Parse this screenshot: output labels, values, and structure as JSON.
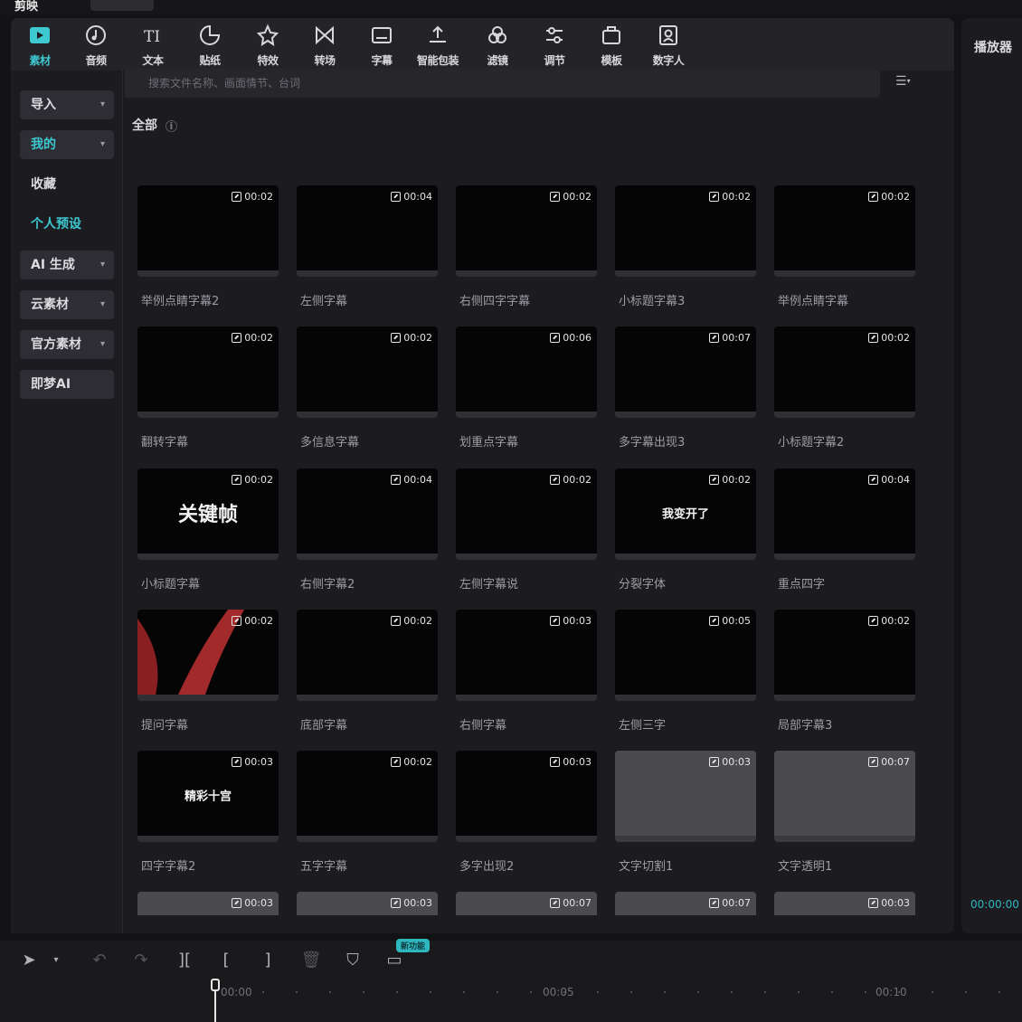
{
  "app": {
    "title": "剪映"
  },
  "toolbar": {
    "tools": [
      {
        "label": "素材",
        "icon": "media-icon",
        "active": true
      },
      {
        "label": "音频",
        "icon": "audio-icon"
      },
      {
        "label": "文本",
        "icon": "text-icon"
      },
      {
        "label": "贴纸",
        "icon": "sticker-icon"
      },
      {
        "label": "特效",
        "icon": "effects-icon"
      },
      {
        "label": "转场",
        "icon": "transition-icon"
      },
      {
        "label": "字幕",
        "icon": "subtitle-icon"
      },
      {
        "label": "智能包装",
        "icon": "smart-pack-icon"
      },
      {
        "label": "滤镜",
        "icon": "filter-icon"
      },
      {
        "label": "调节",
        "icon": "adjust-icon"
      },
      {
        "label": "模板",
        "icon": "template-icon"
      },
      {
        "label": "数字人",
        "icon": "avatar-icon"
      }
    ]
  },
  "sidebar": {
    "items": [
      {
        "label": "导入",
        "style": "btn",
        "chevron": "▾"
      },
      {
        "label": "我的",
        "style": "sel",
        "chevron": "▾"
      },
      {
        "label": "收藏",
        "style": "plain"
      },
      {
        "label": "个人预设",
        "style": "plain accent"
      },
      {
        "label": "AI 生成",
        "style": "btn",
        "chevron": "▾"
      },
      {
        "label": "云素材",
        "style": "btn",
        "chevron": "▾"
      },
      {
        "label": "官方素材",
        "style": "btn",
        "chevron": "▾"
      },
      {
        "label": "即梦AI",
        "style": "btn"
      }
    ]
  },
  "search": {
    "placeholder": "搜索文件名称、画面情节、台词"
  },
  "sort": {
    "icon": "sort-icon",
    "caret": "▾"
  },
  "section": {
    "title": "全部",
    "info": "i"
  },
  "grid": {
    "items": [
      {
        "duration": "00:02",
        "label": "举例点睛字幕2"
      },
      {
        "duration": "00:04",
        "label": "左侧字幕"
      },
      {
        "duration": "00:02",
        "label": "右侧四字字幕"
      },
      {
        "duration": "00:02",
        "label": "小标题字幕3"
      },
      {
        "duration": "00:02",
        "label": "举例点睛字幕"
      },
      {
        "duration": "00:02",
        "label": "翻转字幕"
      },
      {
        "duration": "00:02",
        "label": "多信息字幕"
      },
      {
        "duration": "00:06",
        "label": "划重点字幕"
      },
      {
        "duration": "00:07",
        "label": "多字幕出现3"
      },
      {
        "duration": "00:02",
        "label": "小标题字幕2"
      },
      {
        "duration": "00:02",
        "label": "小标题字幕",
        "thumb_text": "关键帧"
      },
      {
        "duration": "00:04",
        "label": "右侧字幕2"
      },
      {
        "duration": "00:02",
        "label": "左侧字幕说"
      },
      {
        "duration": "00:02",
        "label": "分裂字体",
        "thumb_text": "我变开了"
      },
      {
        "duration": "00:04",
        "label": "重点四字"
      },
      {
        "duration": "00:02",
        "label": "提问字幕"
      },
      {
        "duration": "00:02",
        "label": "底部字幕"
      },
      {
        "duration": "00:03",
        "label": "右侧字幕"
      },
      {
        "duration": "00:05",
        "label": "左侧三字"
      },
      {
        "duration": "00:02",
        "label": "局部字幕3"
      },
      {
        "duration": "00:03",
        "label": "四字字幕2",
        "thumb_text": "精彩十宫"
      },
      {
        "duration": "00:02",
        "label": "五字字幕"
      },
      {
        "duration": "00:03",
        "label": "多字出现2"
      },
      {
        "duration": "00:03",
        "label": "文字切割1"
      },
      {
        "duration": "00:07",
        "label": "文字透明1"
      },
      {
        "duration": "00:03",
        "label": ""
      },
      {
        "duration": "00:03",
        "label": ""
      },
      {
        "duration": "00:07",
        "label": ""
      },
      {
        "duration": "00:07",
        "label": ""
      },
      {
        "duration": "00:03",
        "label": ""
      }
    ]
  },
  "player": {
    "title": "播放器",
    "timecode": "00:00:00"
  },
  "timeline": {
    "new_badge": "新功能",
    "ruler": [
      "00:00",
      "00:05",
      "00:10"
    ]
  }
}
